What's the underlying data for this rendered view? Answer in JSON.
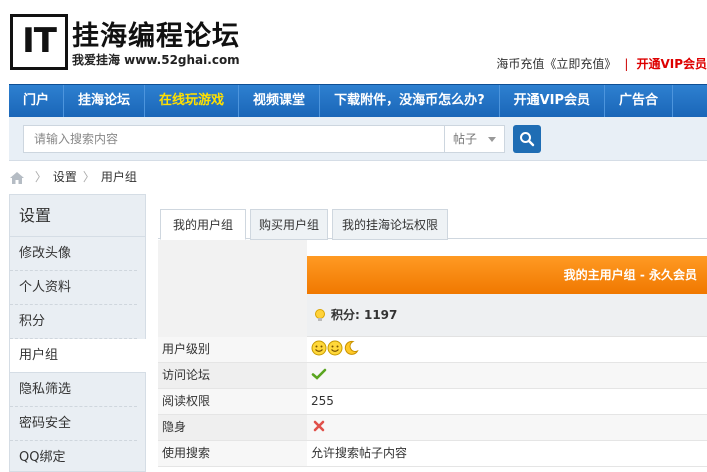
{
  "logo": {
    "mark": "IT",
    "title": "挂海编程论坛",
    "subtitle": "我爱挂海 www.52ghai.com"
  },
  "top_links": {
    "recharge": "海币充值《立即充值》",
    "vip": "开通VIP会员"
  },
  "nav": {
    "items": [
      {
        "label": "门户",
        "highlight": false
      },
      {
        "label": "挂海论坛",
        "highlight": false
      },
      {
        "label": "在线玩游戏",
        "highlight": true
      },
      {
        "label": "视频课堂",
        "highlight": false
      },
      {
        "label": "下载附件，没海币怎么办?",
        "highlight": false
      },
      {
        "label": "开通VIP会员",
        "highlight": false
      },
      {
        "label": "广告合",
        "highlight": false
      }
    ]
  },
  "search": {
    "placeholder": "请输入搜索内容",
    "type": "帖子"
  },
  "breadcrumb": {
    "items": [
      "设置",
      "用户组"
    ]
  },
  "sidebar": {
    "title": "设置",
    "items": [
      {
        "label": "修改头像",
        "active": false
      },
      {
        "label": "个人资料",
        "active": false
      },
      {
        "label": "积分",
        "active": false
      },
      {
        "label": "用户组",
        "active": true
      },
      {
        "label": "隐私筛选",
        "active": false
      },
      {
        "label": "密码安全",
        "active": false
      },
      {
        "label": "QQ绑定",
        "active": false
      }
    ]
  },
  "tabs": [
    {
      "label": "我的用户组",
      "active": true
    },
    {
      "label": "购买用户组",
      "active": false
    },
    {
      "label": "我的挂海论坛权限",
      "active": false
    }
  ],
  "group": {
    "header": "我的主用户组 - 永久会员",
    "points": "积分: 1197",
    "rows": [
      {
        "label": "用户级别",
        "value": "",
        "icon": "smiley-moon-icons"
      },
      {
        "label": "访问论坛",
        "value": "",
        "icon": "check-icon"
      },
      {
        "label": "阅读权限",
        "value": "255",
        "icon": ""
      },
      {
        "label": "隐身",
        "value": "",
        "icon": "cross-icon"
      },
      {
        "label": "使用搜索",
        "value": "允许搜索帖子内容",
        "icon": ""
      }
    ]
  },
  "colors": {
    "nav": "#1a66b8",
    "accent_orange": "#f58a10",
    "vip_red": "#dd0000",
    "highlight_yellow": "#ffe000"
  }
}
